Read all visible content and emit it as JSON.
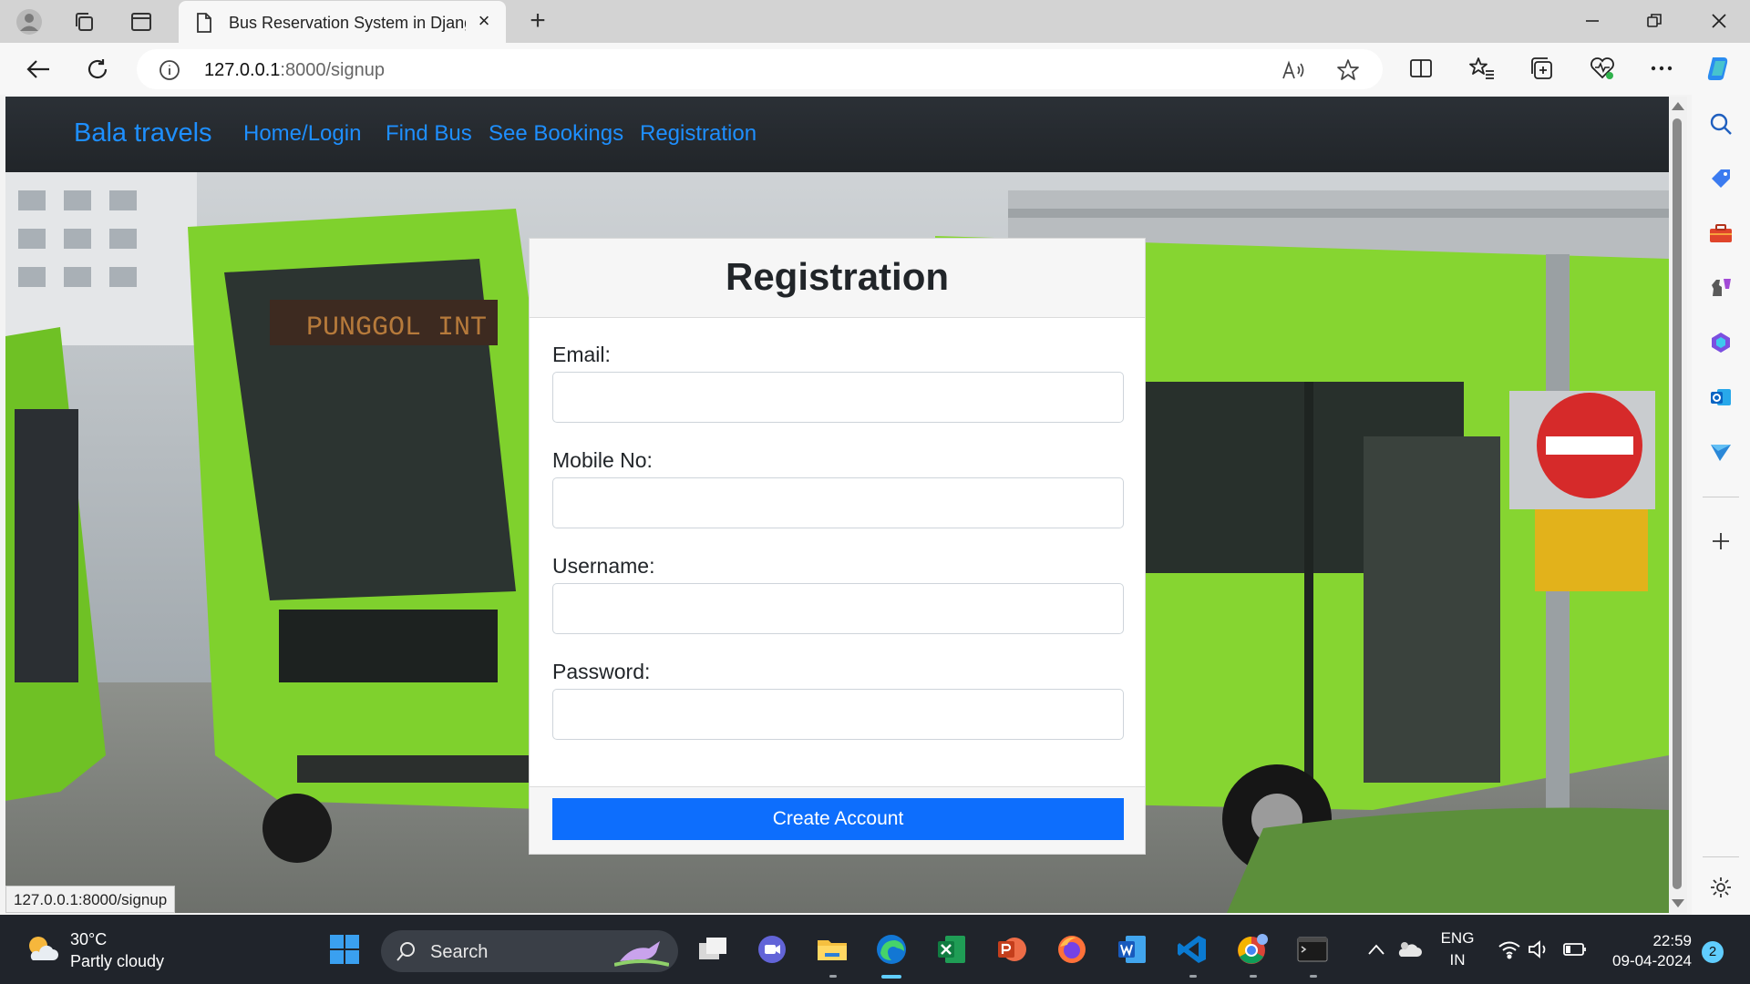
{
  "browser": {
    "tab_title": "Bus Reservation System in Djang",
    "url_host": "127.0.0.1",
    "url_path": ":8000/signup",
    "status_url": "127.0.0.1:8000/signup"
  },
  "site": {
    "brand": "Bala travels",
    "nav": [
      "Home/Login",
      "Find Bus",
      "See Bookings",
      "Registration"
    ]
  },
  "form": {
    "title": "Registration",
    "fields": [
      {
        "label": "Email:",
        "value": ""
      },
      {
        "label": "Mobile No:",
        "value": ""
      },
      {
        "label": "Username:",
        "value": ""
      },
      {
        "label": "Password:",
        "value": ""
      }
    ],
    "submit_label": "Create Account"
  },
  "taskbar": {
    "weather_temp": "30°C",
    "weather_desc": "Partly cloudy",
    "search_label": "Search",
    "lang_top": "ENG",
    "lang_bottom": "IN",
    "time": "22:59",
    "date": "09-04-2024",
    "notification_count": "2"
  },
  "colors": {
    "brand_link": "#1e8fff",
    "navbar": "#212529",
    "primary_button": "#0d6efd",
    "hero_bus_green": "#7fd12d"
  },
  "icons": {
    "tabbar": [
      "profile-icon",
      "workspaces-icon",
      "tab-actions-icon",
      "page-icon",
      "close-icon",
      "new-tab-icon"
    ],
    "window": [
      "minimize-icon",
      "restore-icon",
      "close-window-icon"
    ],
    "addressbar": [
      "back-icon",
      "refresh-icon",
      "site-info-icon",
      "read-aloud-icon",
      "favorite-star-icon",
      "split-screen-icon",
      "favorites-icon",
      "collections-icon",
      "browser-essentials-icon",
      "more-icon",
      "copilot-icon"
    ],
    "sidebar": [
      "search-icon",
      "shopping-icon",
      "tools-icon",
      "games-icon",
      "microsoft365-icon",
      "outlook-icon",
      "send-icon",
      "add-icon",
      "settings-icon"
    ]
  }
}
